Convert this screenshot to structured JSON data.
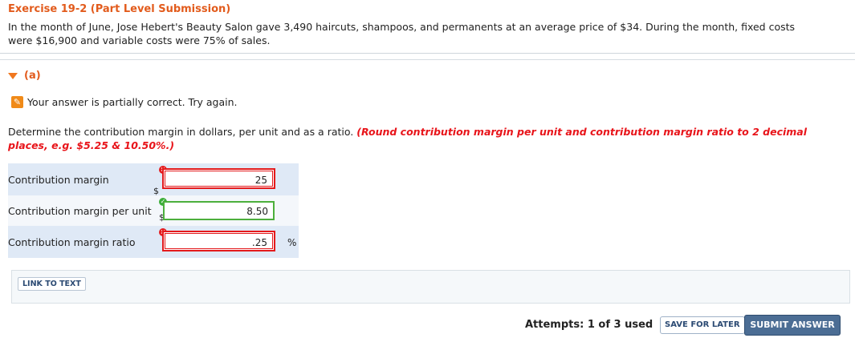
{
  "exercise": {
    "title": "Exercise 19-2 (Part Level Submission)",
    "problem": "In the month of June, Jose Hebert's Beauty Salon gave 3,490 haircuts, shampoos, and permanents at an average price of $34. During the month, fixed costs were $16,900 and variable costs were 75% of sales."
  },
  "part": {
    "label": "(a)",
    "feedback": "Your answer is partially correct.  Try again.",
    "instruction": "Determine the contribution margin in dollars, per unit and as a ratio.",
    "instruction_note": "(Round contribution margin per unit and contribution margin ratio to 2 decimal places, e.g. $5.25 & 10.50%.)"
  },
  "answers": [
    {
      "label": "Contribution margin",
      "prefix": "$",
      "value": "25",
      "suffix": "",
      "status": "incorrect"
    },
    {
      "label": "Contribution margin per unit",
      "prefix": "$",
      "value": "8.50",
      "suffix": "",
      "status": "correct"
    },
    {
      "label": "Contribution margin ratio",
      "prefix": "",
      "value": ".25",
      "suffix": "%",
      "status": "incorrect"
    }
  ],
  "links": {
    "link_to_text": "LINK TO TEXT"
  },
  "footer": {
    "attempts": "Attempts: 1 of 3 used",
    "save_label": "SAVE FOR LATER",
    "submit_label": "SUBMIT ANSWER"
  },
  "colors": {
    "accent_orange": "#e25b1c",
    "error_red": "#e41a1c",
    "ok_green": "#4caf3c",
    "button_blue": "#4b6d94"
  }
}
